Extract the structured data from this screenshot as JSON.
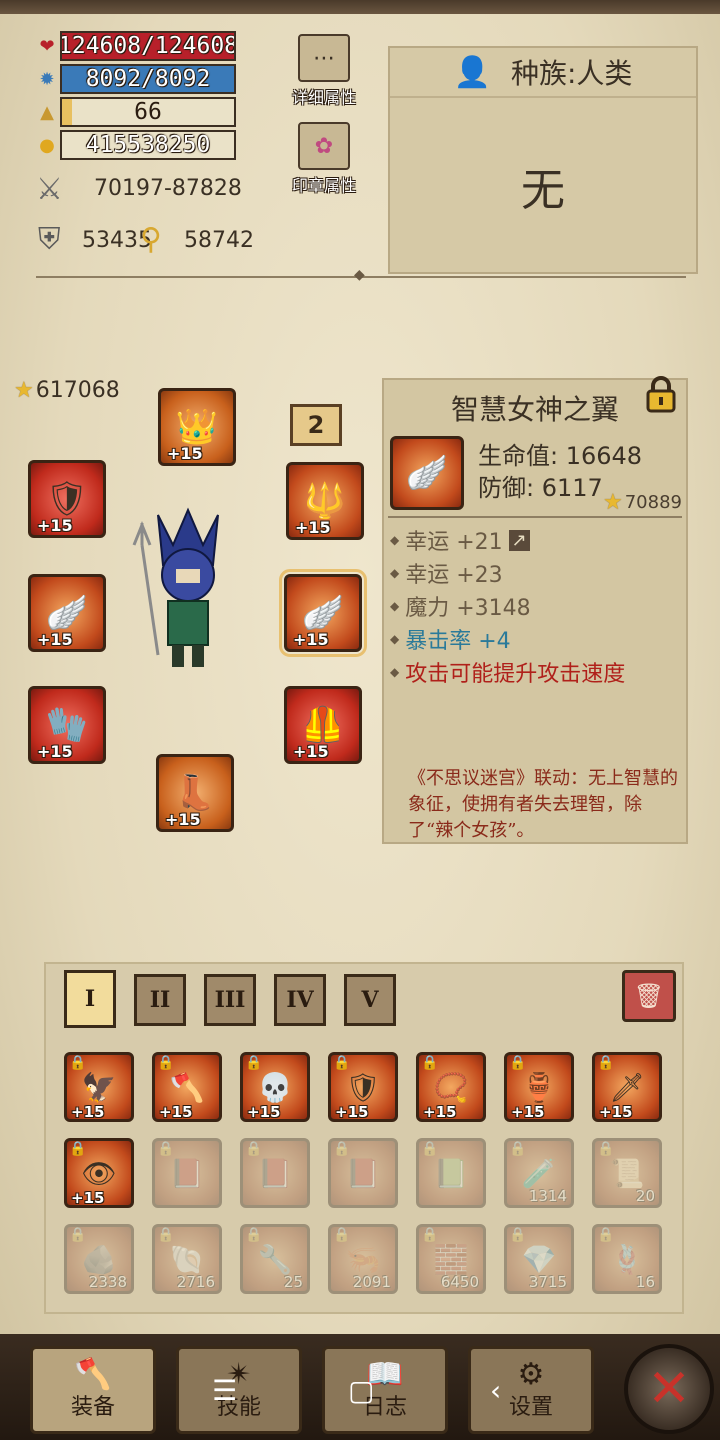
{
  "stats": {
    "hp": "124608/124608",
    "mp": "8092/8092",
    "level": "66",
    "gold": "415538250",
    "attack": "70197-87828",
    "defense": "53435",
    "magic": "58742",
    "hp_fill": 1.0,
    "mp_fill": 1.0,
    "level_fill": 0.06
  },
  "side_buttons": {
    "detail_attrs": "详细属性",
    "seal_attrs": "印章属性"
  },
  "race": {
    "label": "种族:人类",
    "value": "无"
  },
  "equipment": {
    "score": "617068",
    "page_badge": "2",
    "slots": [
      {
        "name": "helmet",
        "plus": "+15"
      },
      {
        "name": "shoulder",
        "plus": "+15"
      },
      {
        "name": "weapon-staff",
        "plus": "+15"
      },
      {
        "name": "cape",
        "plus": "+15"
      },
      {
        "name": "wings",
        "plus": "+15"
      },
      {
        "name": "gloves",
        "plus": "+15"
      },
      {
        "name": "armor",
        "plus": "+15"
      },
      {
        "name": "boots",
        "plus": "+15"
      }
    ]
  },
  "item": {
    "title": "智慧女神之翼",
    "hp_line": "生命值: 16648",
    "def_line": "防御: 6117",
    "score": "70889",
    "plus": "+15",
    "affixes": [
      {
        "text": "幸运 +21",
        "color": "#6a5a44"
      },
      {
        "text": "幸运 +23",
        "color": "#6a5a44"
      },
      {
        "text": "魔力 +3148",
        "color": "#6a5a44"
      },
      {
        "text": "暴击率 +4",
        "color": "#2a7a9a"
      },
      {
        "text": "攻击可能提升攻击速度",
        "color": "#b0201a"
      }
    ],
    "flavor": "《不思议迷宫》联动：无上智慧的象征，使拥有者失去理智，除了“辣个女孩”。"
  },
  "inventory": {
    "tabs": [
      "I",
      "II",
      "III",
      "IV",
      "V"
    ],
    "row1_plus": [
      "+15",
      "+15",
      "+15",
      "+15",
      "+15",
      "+15",
      "+15"
    ],
    "row2": [
      {
        "plus": "+15",
        "count": ""
      },
      {
        "plus": "",
        "count": ""
      },
      {
        "plus": "",
        "count": ""
      },
      {
        "plus": "",
        "count": ""
      },
      {
        "plus": "",
        "count": ""
      },
      {
        "plus": "",
        "count": "1314"
      },
      {
        "plus": "",
        "count": "20"
      }
    ],
    "row3_counts": [
      "2338",
      "2716",
      "25",
      "2091",
      "6450",
      "3715",
      "16"
    ]
  },
  "nav": {
    "equip": "装备",
    "skills": "技能",
    "log": "日志",
    "settings": "设置"
  },
  "colors": {
    "hp_bar": "#b8202a",
    "mp_bar": "#3a7ab8",
    "level_bar": "#e8c060"
  }
}
